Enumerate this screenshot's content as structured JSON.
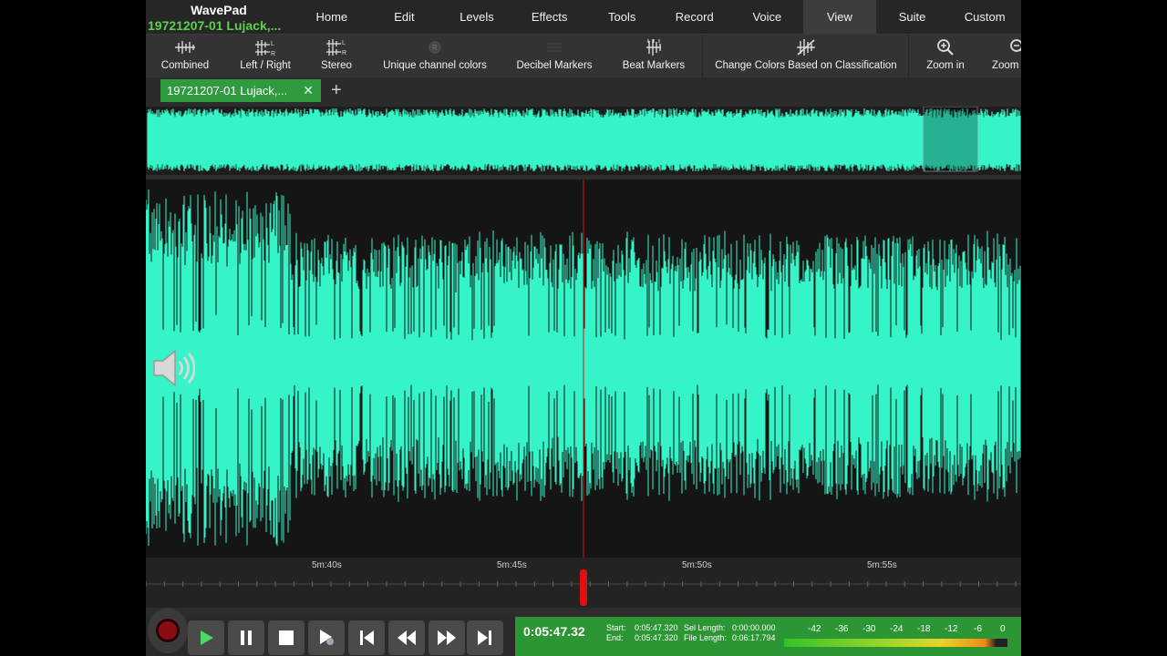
{
  "app": {
    "name": "WavePad",
    "file_short": "19721207-01 Lujack,..."
  },
  "menu": [
    {
      "label": "Home"
    },
    {
      "label": "Edit"
    },
    {
      "label": "Levels"
    },
    {
      "label": "Effects"
    },
    {
      "label": "Tools"
    },
    {
      "label": "Record"
    },
    {
      "label": "Voice"
    },
    {
      "label": "View"
    },
    {
      "label": "Suite"
    },
    {
      "label": "Custom"
    }
  ],
  "active_menu": "View",
  "ribbon": {
    "combined": "Combined",
    "left_right": "Left / Right",
    "stereo": "Stereo",
    "unique_colors": "Unique channel colors",
    "decibel": "Decibel Markers",
    "beat": "Beat Markers",
    "classification": "Change Colors Based on Classification",
    "zoom_in": "Zoom in",
    "zoom_out": "Zoom"
  },
  "tab": {
    "label": "19721207-01 Lujack,...",
    "close": "✕",
    "add": "+"
  },
  "ruler": {
    "ticks": [
      "5m:40s",
      "5m:45s",
      "5m:50s",
      "5m:55s"
    ]
  },
  "transport": {
    "time": "0:05:47.32",
    "start_label": "Start:",
    "start": "0:05:47.320",
    "end_label": "End:",
    "end": "0:05:47.320",
    "sel_label": "Sel Length:",
    "sel": "0:00:00.000",
    "file_label": "File Length:",
    "file": "0:06:17.794"
  },
  "meter": {
    "labels": [
      "-42",
      "-36",
      "-30",
      "-24",
      "-18",
      "-12",
      "-6",
      "0"
    ]
  },
  "colors": {
    "wave": "#35f5c8",
    "accent_green": "#2f9a3e",
    "playhead": "#e01010"
  }
}
